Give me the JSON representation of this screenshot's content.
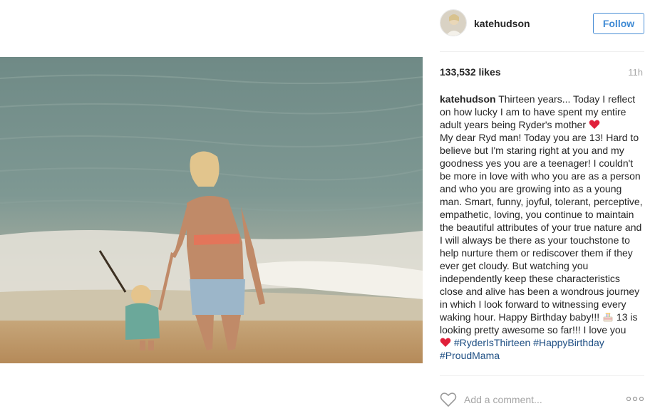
{
  "post": {
    "username": "katehudson",
    "follow_label": "Follow",
    "likes": "133,532 likes",
    "time_ago": "11h",
    "caption": {
      "user": "katehudson",
      "part1": " Thirteen years... Today I reflect on how lucky I am to have spent my entire adult years being Ryder's mother ",
      "part2": "My dear Ryd man! Today you are 13! Hard to believe but I'm staring right at you and my goodness yes you are a teenager! I couldn't be more in love with who you are as a person and who you are growing into as a young man. Smart, funny, joyful, tolerant, perceptive, empathetic, loving, you continue to maintain the beautiful attributes of your true nature and I will always be there as your touchstone to help nurture them or rediscover them if they ever get cloudy. But watching you independently keep these characteristics close and alive has been a wondrous journey in which I look forward to witnessing every waking hour. Happy Birthday baby!!! ",
      "part3": " 13 is looking pretty awesome so far!!! I love you ",
      "hashtag1": "#RyderIsThirteen",
      "hashtag2": "#HappyBirthday",
      "hashtag3": "#ProudMama"
    },
    "comment_placeholder": "Add a comment...",
    "icons": {
      "avatar": "avatar-photo",
      "like": "heart-outline-icon",
      "more": "more-options-icon",
      "emoji_heart": "red-heart-emoji",
      "emoji_cake": "birthday-cake-emoji"
    },
    "colors": {
      "follow_border": "#4b8fd6",
      "follow_text": "#3f8ad4",
      "hashtag": "#1d4e83",
      "muted": "#a5a5a5",
      "heart": "#e0203a"
    }
  }
}
